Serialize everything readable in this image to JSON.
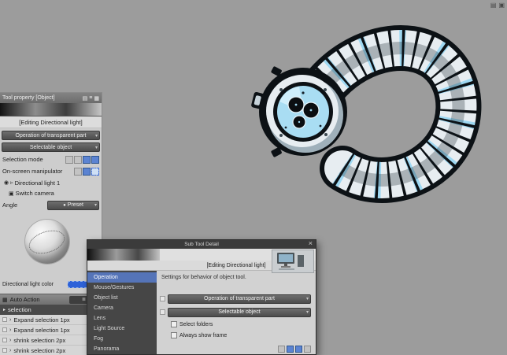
{
  "icons": {
    "dropdown_arrow": "▾",
    "close": "×",
    "row_arrow": "›",
    "grip": "⋮⋮",
    "expander": "▸",
    "tree_arrow": "▹",
    "light": "◉",
    "camera": "▣",
    "ball": "●",
    "menu": "≣",
    "panel_min": "▤",
    "panel_menu": "≡",
    "note": "▦",
    "window_a": "▤",
    "window_b": "▣"
  },
  "tool_property": {
    "title": "Tool property [Object]",
    "editing_label": "[Editing Directional light]",
    "transparent_part": "Operation of transparent part",
    "selectable_object": "Selectable object",
    "selection_mode": "Selection mode",
    "on_screen_manipulator": "On-screen manipulator",
    "directional_light": "Directional light 1",
    "switch_camera": "Switch camera",
    "angle": "Angle",
    "preset": "Preset",
    "light_color_label": "Directional light color"
  },
  "auto_action": {
    "title": "Auto Action",
    "set_name": "selection",
    "actions": [
      "Expand selection 1px",
      "Expand selection 1px",
      "shrink selection 2px",
      "shrink selection 2px"
    ]
  },
  "sub_tool_detail": {
    "title": "Sub Tool Detail",
    "editing_label": "[Editing Directional light]",
    "description": "Settings for behavior of object tool.",
    "categories": [
      "Operation",
      "Mouse/Gestures",
      "Object list",
      "Camera",
      "Lens",
      "Light Source",
      "Fog",
      "Panorama"
    ],
    "selected_category": "Operation",
    "dropdown1": "Operation of transparent part",
    "dropdown2": "Selectable object",
    "checkbox1": "Select folders",
    "checkbox2": "Always show frame"
  },
  "colors": {
    "canvas": "#9c9c9c",
    "accent_blue": "#5574b8",
    "light_color_swatch": "#2e62d8",
    "watch_dial": "#a9ddf3"
  }
}
